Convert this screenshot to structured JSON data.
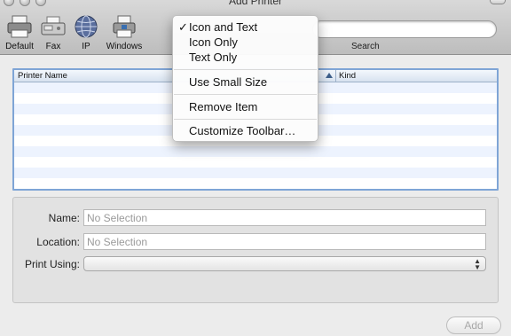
{
  "window": {
    "title": "Add Printer"
  },
  "toolbar": {
    "items": [
      {
        "label": "Default",
        "icon": "default-printer-icon"
      },
      {
        "label": "Fax",
        "icon": "fax-icon"
      },
      {
        "label": "IP",
        "icon": "globe-icon"
      },
      {
        "label": "Windows",
        "icon": "windows-printer-icon"
      }
    ],
    "search_label": "Search"
  },
  "context_menu": {
    "items": [
      {
        "label": "Icon and Text",
        "checked": true
      },
      {
        "label": "Icon Only",
        "checked": false
      },
      {
        "label": "Text Only",
        "checked": false
      },
      {
        "label": "Use Small Size",
        "checked": false
      },
      {
        "label": "Remove Item",
        "checked": false
      },
      {
        "label": "Customize Toolbar…",
        "checked": false
      }
    ],
    "check_glyph": "✓"
  },
  "printer_list": {
    "columns": [
      "Printer Name",
      "Kind"
    ],
    "rows": []
  },
  "details": {
    "name_label": "Name:",
    "name_placeholder": "No Selection",
    "location_label": "Location:",
    "location_placeholder": "No Selection",
    "print_using_label": "Print Using:",
    "print_using_value": ""
  },
  "add_button": "Add",
  "colors": {
    "selection_border": "#7fa5d6",
    "row_stripe": "#edf3fe"
  }
}
